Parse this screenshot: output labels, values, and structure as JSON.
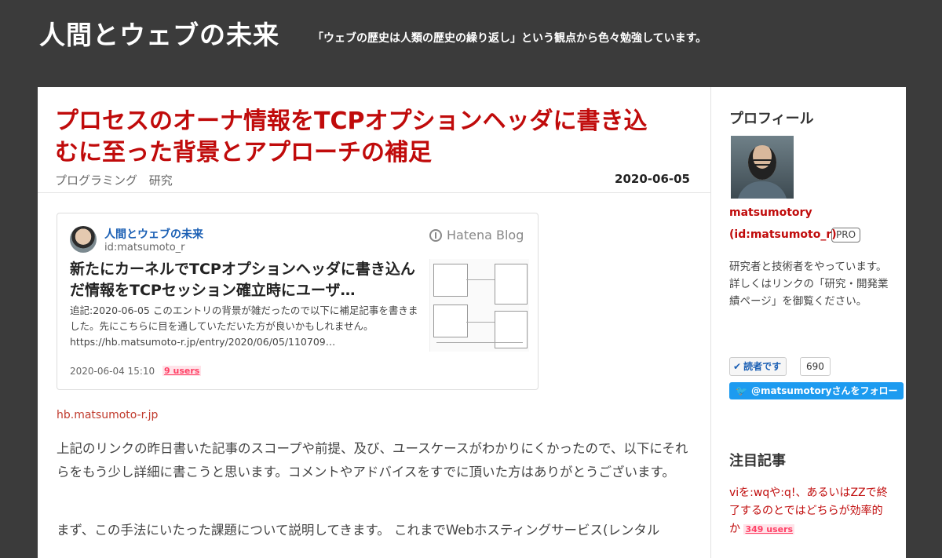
{
  "header": {
    "title": "人間とウェブの未来",
    "description": "「ウェブの歴史は人類の歴史の繰り返し」という観点から色々勉強しています。"
  },
  "entry": {
    "title": "プロセスのオーナ情報をTCPオプションヘッダに書き込むに至った背景とアプローチの補足",
    "categories": [
      "プログラミング",
      "研究"
    ],
    "date": "2020-06-05"
  },
  "embed": {
    "blog_name": "人間とウェブの未来",
    "blog_id": "id:matsumoto_r",
    "brand": "Hatena Blog",
    "title": "新たにカーネルでTCPオプションヘッダに書き込んだ情報をTCPセッション確立時にユーザ…",
    "excerpt": "追記:2020-06-05 このエントリの背景が雑だったので以下に補足記事を書きました。先にこちらに目を通していただいた方が良いかもしれません。 https://hb.matsumoto-r.jp/entry/2020/06/05/110709…",
    "date": "2020-06-04 15:10",
    "users": "9 users"
  },
  "body": {
    "source_link": "hb.matsumoto-r.jp",
    "para1": "上記のリンクの昨日書いた記事のスコープや前提、及び、ユースケースがわかりにくかったので、以下にそれらをもう少し詳細に書こうと思います。コメントやアドバイスをすでに頂いた方はありがとうございます。",
    "para2": "まず、この手法にいたった課題について説明してきます。 これまでWebホスティングサービス(レンタル"
  },
  "sidebar": {
    "profile_heading": "プロフィール",
    "profile_name": "matsumotory",
    "profile_id": "(id:matsumoto_r)",
    "pro_badge": "PRO",
    "profile_desc": "研究者と技術者をやっています。 詳しくはリンクの「研究・開発業績ページ」を御覧ください。",
    "reader_label": "読者です",
    "reader_count": "690",
    "twitter_follow": "@matsumotoryさんをフォロー",
    "featured_heading": "注目記事",
    "featured_title": "viを:wqや:q!、あるいはZZで終了するのとではどちらが効率的か",
    "featured_users": "349 users"
  },
  "colors": {
    "background": "#3b3b3b",
    "accent": "#c00b0b",
    "link_blue": "#1a5fb4",
    "bookmark_pink": "#ff4166",
    "twitter": "#1d9bf0"
  }
}
